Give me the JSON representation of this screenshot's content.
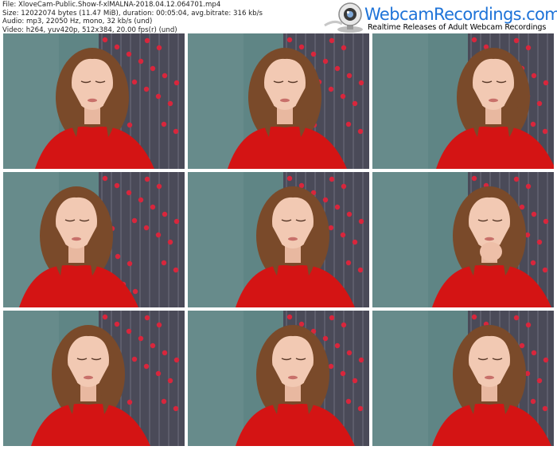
{
  "file_info": {
    "file": "File: XloveCam-Public.Show-f-xlMALNA-2018.04.12.064701.mp4",
    "size": "Size: 12022074 bytes (11.47 MiB), duration: 00:05:04, avg.bitrate: 316 kb/s",
    "audio": "Audio: mp3, 22050 Hz, mono, 32 kb/s (und)",
    "video": "Video: h264, yuv420p, 512x384, 20.00 fps(r) (und)"
  },
  "logo": {
    "brand": "WebcamRecordings.com",
    "tagline": "Realtime Releases of Adult Webcam Recordings",
    "icon": "webcam-icon",
    "brand_color": "#1e73d8"
  },
  "thumbnails": [
    {
      "pose": "looking-down-left",
      "shift": 0
    },
    {
      "pose": "profile-left",
      "shift": 10
    },
    {
      "pose": "looking-down",
      "shift": 40
    },
    {
      "pose": "looking-down-far",
      "shift": -20
    },
    {
      "pose": "looking-aside",
      "shift": 20
    },
    {
      "pose": "hand-on-chin",
      "shift": 35
    },
    {
      "pose": "looking-down-left",
      "shift": -5
    },
    {
      "pose": "looking-down",
      "shift": 20
    },
    {
      "pose": "looking-down",
      "shift": 35
    }
  ],
  "colors": {
    "wall": "#5f8585",
    "curtain": "#4a4a58",
    "dots": "#d8263c",
    "sweater": "#d41414",
    "hair": "#7a4a2a",
    "skin": "#f2c9b3"
  }
}
